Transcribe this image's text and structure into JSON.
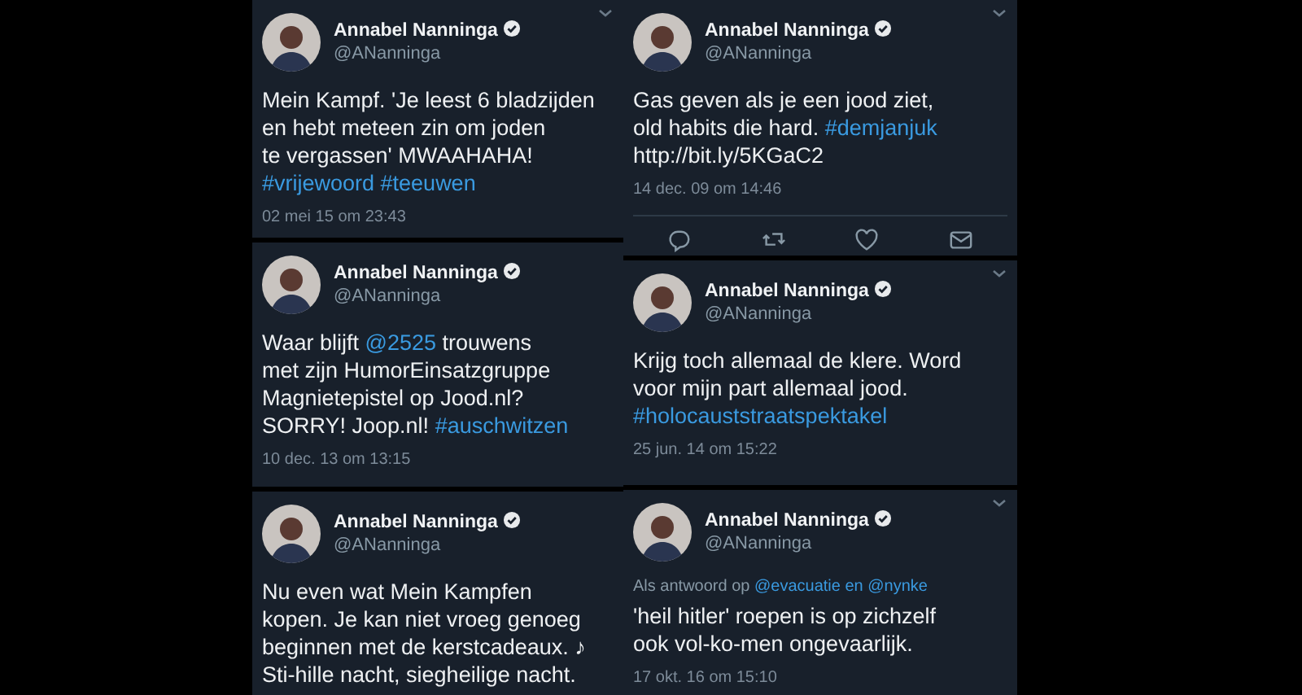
{
  "left_column": [
    {
      "name": "Annabel Nanninga",
      "handle": "@ANanninga",
      "verified": true,
      "chevron": true,
      "lines": [
        [
          {
            "kind": "text",
            "text": "Mein Kampf. 'Je leest 6 bladzijden"
          }
        ],
        [
          {
            "kind": "text",
            "text": "en hebt meteen zin om joden"
          }
        ],
        [
          {
            "kind": "text",
            "text": "te vergassen' MWAAHAHA!"
          }
        ],
        [
          {
            "kind": "link",
            "text": "#vrijewoord #teeuwen"
          }
        ]
      ],
      "timestamp": "02 mei 15 om 23:43"
    },
    {
      "name": "Annabel Nanninga",
      "handle": "@ANanninga",
      "verified": true,
      "chevron": false,
      "lines": [
        [
          {
            "kind": "text",
            "text": "Waar blijft "
          },
          {
            "kind": "link",
            "text": "@2525"
          },
          {
            "kind": "text",
            "text": " trouwens"
          }
        ],
        [
          {
            "kind": "text",
            "text": "met zijn HumorEinsatzgruppe"
          }
        ],
        [
          {
            "kind": "text",
            "text": "Magnietepistel op Jood.nl?"
          }
        ],
        [
          {
            "kind": "text",
            "text": "SORRY! Joop.nl! "
          },
          {
            "kind": "link",
            "text": "#auschwitzen"
          }
        ]
      ],
      "timestamp": "10 dec. 13 om 13:15"
    },
    {
      "name": "Annabel Nanninga",
      "handle": "@ANanninga",
      "verified": true,
      "chevron": false,
      "lines": [
        [
          {
            "kind": "text",
            "text": "Nu even wat Mein Kampfen"
          }
        ],
        [
          {
            "kind": "text",
            "text": "kopen. Je kan niet vroeg genoeg"
          }
        ],
        [
          {
            "kind": "text",
            "text": "beginnen met de kerstcadeaux. ♪"
          }
        ],
        [
          {
            "kind": "text",
            "text": "Sti-hille nacht, siegheilige nacht."
          }
        ]
      ]
    }
  ],
  "right_column": [
    {
      "name": "Annabel Nanninga",
      "handle": "@ANanninga",
      "verified": true,
      "chevron": true,
      "lines": [
        [
          {
            "kind": "text",
            "text": "Gas geven als je een jood ziet,"
          }
        ],
        [
          {
            "kind": "text",
            "text": "old habits die hard. "
          },
          {
            "kind": "link",
            "text": "#demjanjuk"
          }
        ],
        [
          {
            "kind": "text",
            "text": "http://bit.ly/5KGaC2"
          }
        ]
      ],
      "timestamp": "14 dec. 09 om 14:46",
      "actions": [
        {
          "kind": "reply"
        },
        {
          "kind": "retweet"
        },
        {
          "kind": "like"
        },
        {
          "kind": "message"
        }
      ]
    },
    {
      "name": "Annabel Nanninga",
      "handle": "@ANanninga",
      "verified": true,
      "chevron": true,
      "lines": [
        [
          {
            "kind": "text",
            "text": "Krijg toch allemaal de klere. Word"
          }
        ],
        [
          {
            "kind": "text",
            "text": "voor mijn part allemaal jood."
          }
        ],
        [
          {
            "kind": "link",
            "text": "#holocauststraatspektakel"
          }
        ]
      ],
      "timestamp": "25 jun. 14 om 15:22"
    },
    {
      "name": "Annabel Nanninga",
      "handle": "@ANanninga",
      "verified": true,
      "chevron": true,
      "reply_to": [
        {
          "kind": "text",
          "text": "Als antwoord op "
        },
        {
          "kind": "link",
          "text": "@evacuatie en @nynke"
        }
      ],
      "lines": [
        [
          {
            "kind": "text",
            "text": "'heil hitler' roepen is op zichzelf"
          }
        ],
        [
          {
            "kind": "text",
            "text": "ook vol-ko-men ongevaarlijk."
          }
        ]
      ],
      "timestamp": "17 okt. 16 om 15:10"
    }
  ]
}
